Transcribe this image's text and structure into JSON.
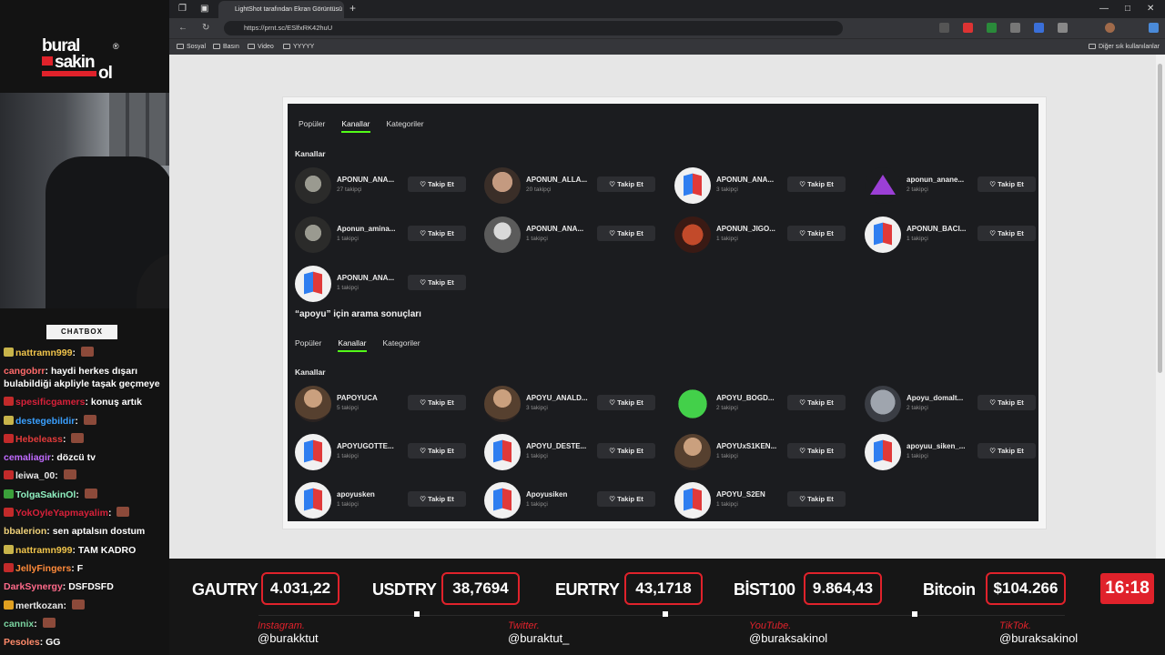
{
  "logo": {
    "line1": "bural",
    "line2": "sakin",
    "line3": "ol",
    "reg": "®"
  },
  "chat": {
    "label": "CHATBOX",
    "messages": [
      {
        "user": "nattramn999",
        "text": "",
        "color": "#f0c44b",
        "badge": "#c8b44a",
        "emote": true
      },
      {
        "user": "cangobrr",
        "text": "haydi herkes dışarı bulabildiği akpliyle taşak geçmeye",
        "color": "#ff6a6a",
        "badge": "",
        "emote": false,
        "wrap": true
      },
      {
        "user": "spesificgamers",
        "text": "konuş artık",
        "color": "#d8213a",
        "badge": "#c22a2a",
        "emote": false
      },
      {
        "user": "destegebildir",
        "text": "",
        "color": "#3aa0ff",
        "badge": "#c8b44a",
        "emote": true
      },
      {
        "user": "Hebeleass",
        "text": "",
        "color": "#e23a3a",
        "badge": "#c22a2a",
        "emote": true
      },
      {
        "user": "cemaliagir",
        "text": "dözcü tv",
        "color": "#c06aff",
        "badge": "",
        "emote": false
      },
      {
        "user": "leiwa_00",
        "text": "",
        "color": "#e8e8e8",
        "badge": "#c22a2a",
        "emote": true
      },
      {
        "user": "TolgaSakinOl",
        "text": "",
        "color": "#8ff0c0",
        "badge": "#3aa03a",
        "emote": true
      },
      {
        "user": "YokOyleYapmayalim",
        "text": "",
        "color": "#d8213a",
        "badge": "#c22a2a",
        "emote": true
      },
      {
        "user": "bbalerion",
        "text": "sen aptalsın dostum",
        "color": "#f0d27a",
        "badge": "",
        "emote": false
      },
      {
        "user": "nattramn999",
        "text": "TAM KADRO",
        "color": "#f0c44b",
        "badge": "#c8b44a",
        "emote": false
      },
      {
        "user": "JellyFingers",
        "text": "F",
        "color": "#ff8a3a",
        "badge": "#c22a2a",
        "emote": false
      },
      {
        "user": "DarkSynergy",
        "text": "DSFDSFD",
        "color": "#ff6a8a",
        "badge": "",
        "emote": false
      },
      {
        "user": "mertkozan",
        "text": "",
        "color": "#e8e8e8",
        "badge": "#e0a020",
        "emote": true
      },
      {
        "user": "cannix",
        "text": "",
        "color": "#7ad3a0",
        "badge": "",
        "emote": true
      },
      {
        "user": "Pesoles",
        "text": "GG",
        "color": "#ff8a6a",
        "badge": "",
        "emote": false
      }
    ]
  },
  "browser": {
    "tab_title": "LightShot tarafından Ekran Görüntüsü",
    "url": "https://prnt.sc/ESlfxRK42huU",
    "bookmarks": [
      "Sosyal",
      "Basın",
      "Video",
      "YYYYY"
    ],
    "bookmarks_right": "Diğer sık kullanılanlar"
  },
  "shot": {
    "top_tabs": [
      "Popüler",
      "Kanallar",
      "Kategoriler"
    ],
    "top_section": "Kanallar",
    "top_channels": [
      {
        "name": "APONUN_ANA...",
        "followers": "27 takipçi",
        "av": "dark"
      },
      {
        "name": "APONUN_ALLA...",
        "followers": "20 takipçi",
        "av": "face"
      },
      {
        "name": "APONUN_ANA...",
        "followers": "3 takipçi",
        "av": "cube"
      },
      {
        "name": "aponun_anane...",
        "followers": "2 takipçi",
        "av": "purple"
      },
      {
        "name": "Aponun_amina...",
        "followers": "1 takipçi",
        "av": "dark"
      },
      {
        "name": "APONUN_ANA...",
        "followers": "1 takipçi",
        "av": "gm"
      },
      {
        "name": "APONUN_JIGO...",
        "followers": "1 takipçi",
        "av": "red"
      },
      {
        "name": "APONUN_BACI...",
        "followers": "1 takipçi",
        "av": "cube"
      },
      {
        "name": "APONUN_ANA...",
        "followers": "1 takipçi",
        "av": "cube"
      }
    ],
    "search_heading": "“apoyu” için arama sonuçları",
    "tabs2": [
      "Popüler",
      "Kanallar",
      "Kategoriler"
    ],
    "section2": "Kanallar",
    "channels2": [
      {
        "name": "PAPOYUCA",
        "followers": "5 takipçi",
        "av": "photo"
      },
      {
        "name": "APOYU_ANALD...",
        "followers": "3 takipçi",
        "av": "photo"
      },
      {
        "name": "APOYU_BOGD...",
        "followers": "2 takipçi",
        "av": "green"
      },
      {
        "name": "Apoyu_domalt...",
        "followers": "2 takipçi",
        "av": "grey"
      },
      {
        "name": "APOYUGOTTE...",
        "followers": "1 takipçi",
        "av": "cube"
      },
      {
        "name": "APOYU_DESTE...",
        "followers": "1 takipçi",
        "av": "cube"
      },
      {
        "name": "APOYUxS1KEN...",
        "followers": "1 takipçi",
        "av": "photo"
      },
      {
        "name": "apoyuu_siken_...",
        "followers": "1 takipçi",
        "av": "cube"
      },
      {
        "name": "apoyusken",
        "followers": "1 takipçi",
        "av": "cube"
      },
      {
        "name": "Apoyusiken",
        "followers": "1 takipçi",
        "av": "cube"
      },
      {
        "name": "APOYU_S2EN",
        "followers": "1 takipçi",
        "av": "cube"
      }
    ],
    "follow_label": "♡ Takip Et"
  },
  "ticker": {
    "items": [
      {
        "label": "GAUTRY",
        "value": "4.031,22"
      },
      {
        "label": "USDTRY",
        "value": "38,7694"
      },
      {
        "label": "EURTRY",
        "value": "43,1718"
      },
      {
        "label": "BİST100",
        "value": "9.864,43"
      },
      {
        "label": "Bitcoin",
        "value": "$104.266"
      }
    ],
    "clock": "16:18",
    "socials": [
      {
        "platform": "Instagram.",
        "handle": "@burakktut"
      },
      {
        "platform": "Twitter.",
        "handle": "@buraktut_"
      },
      {
        "platform": "YouTube.",
        "handle": "@buraksakinol"
      },
      {
        "platform": "TikTok.",
        "handle": "@buraksakinol"
      }
    ]
  },
  "colors": {
    "accent": "#e0222b",
    "kick_green": "#53fc18"
  }
}
